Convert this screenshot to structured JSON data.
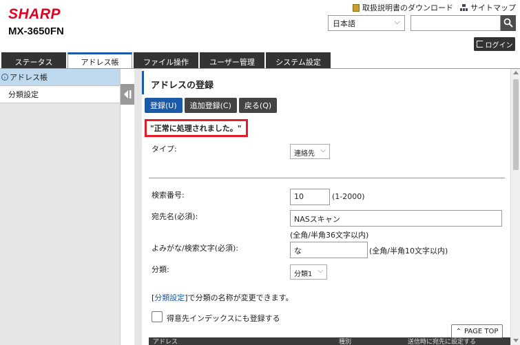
{
  "brand": {
    "logo": "SHARP",
    "model": "MX-3650FN",
    "accent": "#1a5aa8",
    "logo_color": "#e1001f"
  },
  "toplinks": {
    "manual": "取扱説明書のダウンロード",
    "sitemap": "サイトマップ"
  },
  "language": {
    "selected": "日本語"
  },
  "search": {
    "value": ""
  },
  "login_label": "ログイン",
  "tabs": [
    {
      "label": "ステータス"
    },
    {
      "label": "アドレス帳"
    },
    {
      "label": "ファイル操作"
    },
    {
      "label": "ユーザー管理"
    },
    {
      "label": "システム設定"
    }
  ],
  "leftnav": {
    "items": [
      {
        "label": "アドレス帳"
      },
      {
        "label": "分類設定"
      }
    ]
  },
  "main": {
    "title": "アドレスの登録",
    "buttons": {
      "register": "登録(U)",
      "add_register": "追加登録(C)",
      "back": "戻る(Q)"
    },
    "message": "\"正常に処理されました。\"",
    "type": {
      "label": "タイプ:",
      "value": "連絡先"
    },
    "search_number": {
      "label": "検索番号:",
      "value": "10",
      "range": "(1-2000)"
    },
    "dest_name": {
      "label": "宛先名(必須):",
      "value": "NASスキャン",
      "hint": "(全角/半角36文字以内)"
    },
    "yomigana": {
      "label": "よみがな/検索文字(必須):",
      "value": "な",
      "hint": "(全角/半角10文字以内)"
    },
    "category": {
      "label": "分類:",
      "value": "分類1"
    },
    "category_note": {
      "link": "分類設定",
      "bracket_open": "[",
      "bracket_close": "]",
      "text": "で分類の名称が変更できます。"
    },
    "favorite": {
      "label": "得意先インデックスにも登録する",
      "checked": false
    },
    "table_headers": {
      "col1": "アドレス",
      "col2": "種別",
      "col3": "送信時に宛先に設定する"
    }
  },
  "pagetop": "PAGE TOP"
}
